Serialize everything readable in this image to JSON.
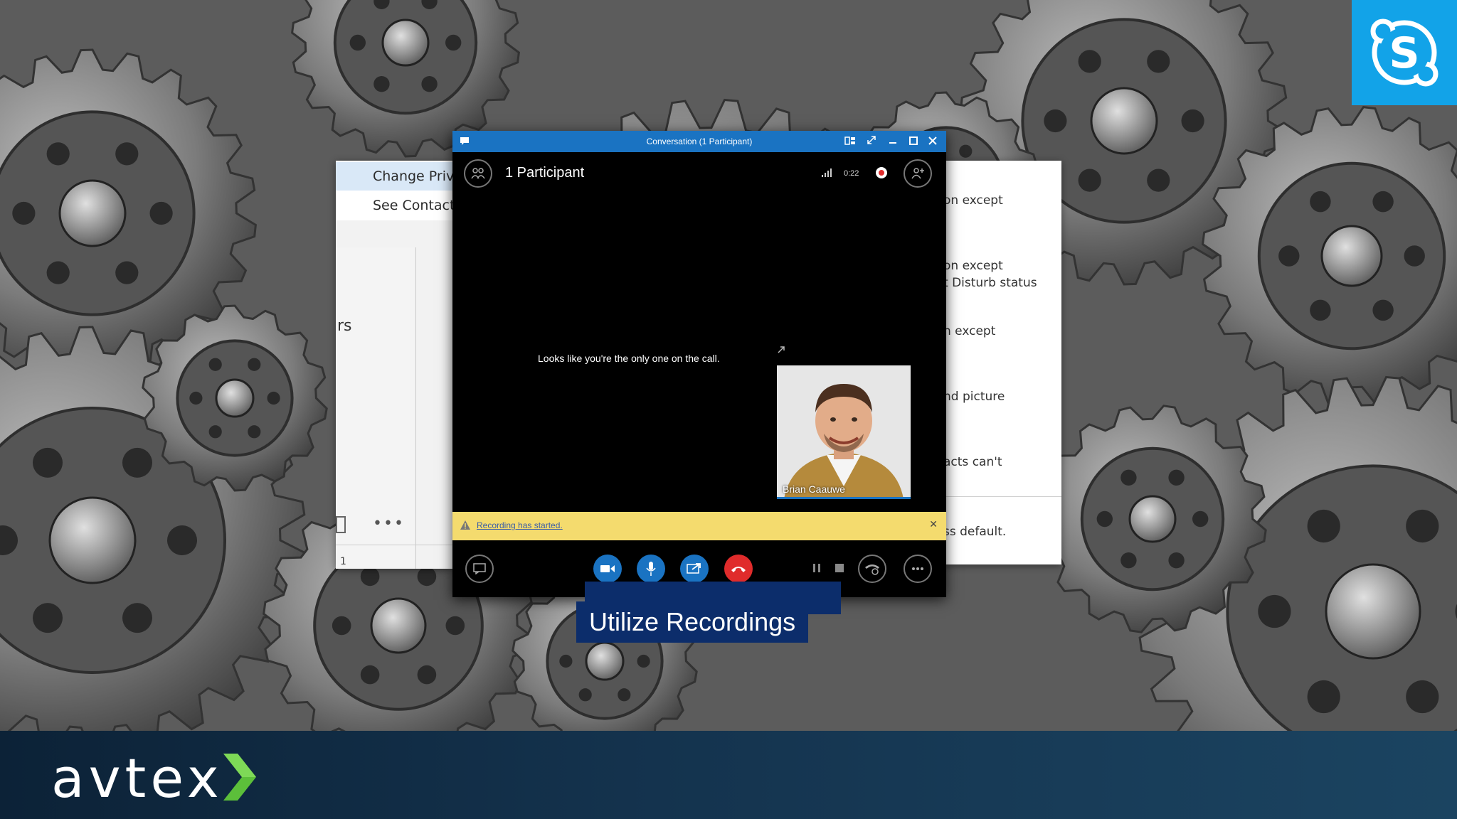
{
  "background": {
    "brand_color": "#12a3e8"
  },
  "left_window": {
    "menu": [
      "Change Priva",
      "See Contact C"
    ],
    "side_text": "rs",
    "more_glyph": "•••",
    "page_num": "1"
  },
  "right_window": {
    "lines": [
      "on except",
      "on except",
      "t Disturb status",
      "n except",
      "nd picture",
      "acts can't",
      "ss default."
    ]
  },
  "conversation": {
    "window_title": "Conversation (1 Participant)",
    "participant_count": "1 Participant",
    "timer": "0:22",
    "alone_message": "Looks like you're the only one on the call.",
    "participant_name": "Brian Caauwe",
    "notification": "Recording has started.",
    "colors": {
      "titlebar": "#1a73c2",
      "notification": "#f4db6e",
      "hangup": "#e02b2b"
    },
    "toolbar_icons": [
      "chat-icon",
      "video-icon",
      "microphone-icon",
      "share-screen-icon",
      "hangup-icon",
      "pause-icon",
      "stop-icon",
      "call-controls-icon",
      "more-options-icon"
    ]
  },
  "caption": {
    "text": "Utilize Recordings"
  },
  "footer": {
    "brand": "avtex"
  }
}
